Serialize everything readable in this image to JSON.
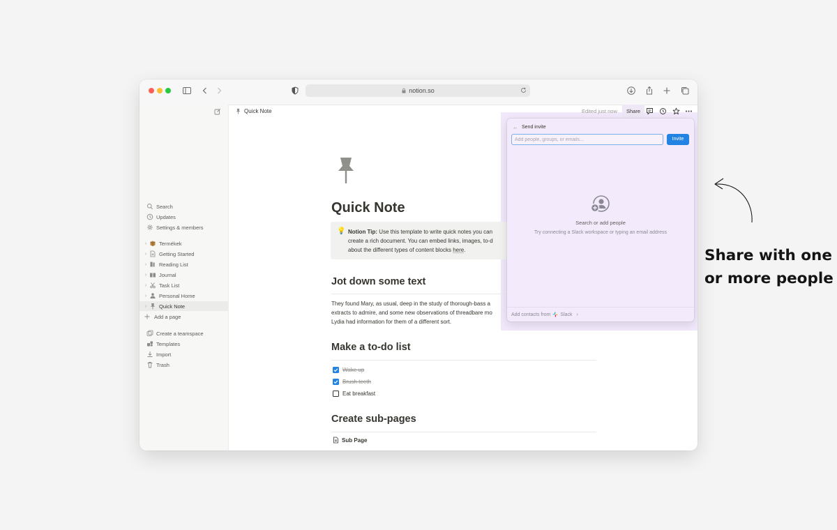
{
  "browser": {
    "url": "notion.so",
    "traffic_lights": [
      "#ff5f57",
      "#febc2e",
      "#28c840"
    ]
  },
  "sidebar": {
    "top_items": [
      {
        "label": "Search",
        "icon": "search-icon"
      },
      {
        "label": "Updates",
        "icon": "clock-icon"
      },
      {
        "label": "Settings & members",
        "icon": "gear-icon"
      }
    ],
    "pages": [
      {
        "label": "Termékek",
        "icon": "box-icon"
      },
      {
        "label": "Getting Started",
        "icon": "document-icon"
      },
      {
        "label": "Reading List",
        "icon": "books-icon"
      },
      {
        "label": "Journal",
        "icon": "book-icon"
      },
      {
        "label": "Task List",
        "icon": "scissors-icon"
      },
      {
        "label": "Personal Home",
        "icon": "person-icon"
      },
      {
        "label": "Quick Note",
        "icon": "pushpin-icon"
      }
    ],
    "add_page": "Add a page",
    "bottom_items": [
      {
        "label": "Create a teamspace",
        "icon": "teamspace-icon"
      },
      {
        "label": "Templates",
        "icon": "templates-icon"
      },
      {
        "label": "Import",
        "icon": "import-icon"
      },
      {
        "label": "Trash",
        "icon": "trash-icon"
      }
    ]
  },
  "topbar": {
    "breadcrumb": "Quick Note",
    "edited": "Edited just now",
    "share_label": "Share"
  },
  "page": {
    "title": "Quick Note",
    "callout": {
      "emoji": "💡",
      "bold": "Notion Tip:",
      "lines": [
        "Use this template to write quick notes you can",
        "create a rich document. You can embed links, images, to-d",
        "about the different types of content blocks"
      ],
      "link": "here",
      "end": "."
    },
    "sections": [
      {
        "heading": "Jot down some text"
      },
      {
        "heading": "Make a to-do list"
      },
      {
        "heading": "Create sub-pages"
      }
    ],
    "paragraph_lines": [
      "They found Mary, as usual, deep in the study of thorough-bass a",
      "extracts to admire, and some new observations of threadbare mo",
      "Lydia had information for them of a different sort."
    ],
    "todos": [
      {
        "label": "Wake up",
        "checked": true
      },
      {
        "label": "Brush teeth",
        "checked": true
      },
      {
        "label": "Eat breakfast",
        "checked": false
      }
    ],
    "subpage": "Sub Page"
  },
  "share_popover": {
    "header": "Send invite",
    "input_placeholder": "Add people, groups, or emails...",
    "invite_label": "Invite",
    "empty_title": "Search or add people",
    "empty_desc": "Try connecting a Slack workspace or typing an email address",
    "footer_prefix": "Add contacts from",
    "footer_service": "Slack"
  },
  "annotation": {
    "line1": "Share with one",
    "line2": "or more people"
  },
  "colors": {
    "accent": "#2383e2",
    "highlight": "#f1e8fb"
  }
}
